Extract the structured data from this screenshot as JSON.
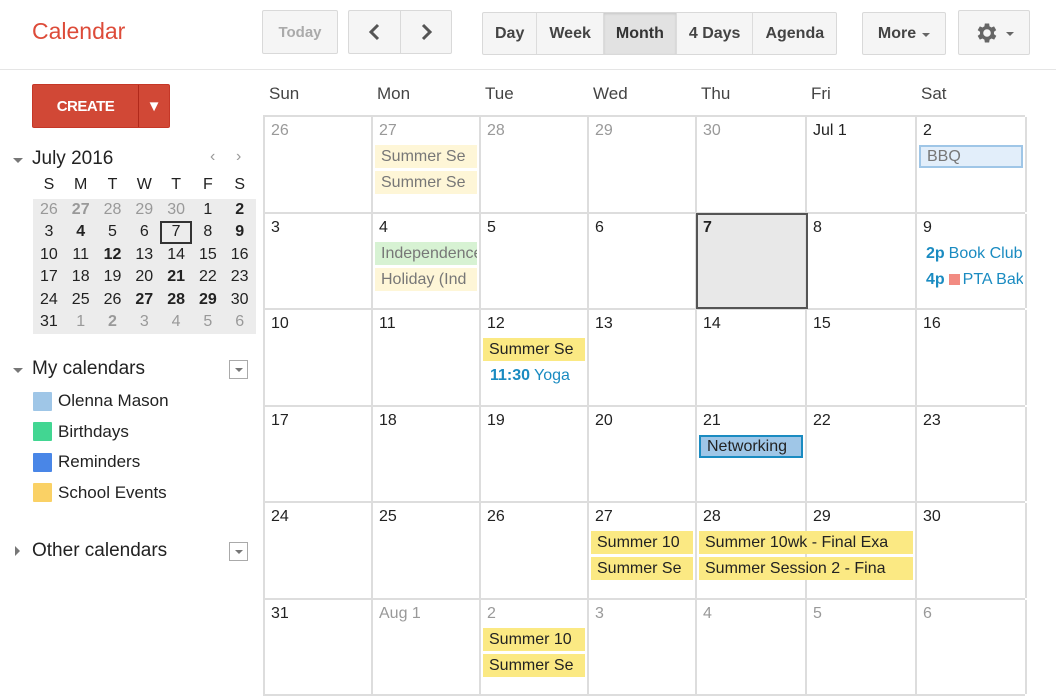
{
  "header": {
    "app_title": "Calendar",
    "today_label": "Today",
    "prev_label": "‹",
    "next_label": "›",
    "views": [
      {
        "label": "Day",
        "active": false
      },
      {
        "label": "Week",
        "active": false
      },
      {
        "label": "Month",
        "active": true
      },
      {
        "label": "4 Days",
        "active": false
      },
      {
        "label": "Agenda",
        "active": false
      }
    ],
    "more_label": "More",
    "settings_icon": "gear-icon"
  },
  "sidebar": {
    "create_label": "CREATE",
    "create_dropdown": "▼",
    "mini_calendar": {
      "title": "July 2016",
      "prev": "‹",
      "next": "›",
      "dow": [
        "S",
        "M",
        "T",
        "W",
        "T",
        "F",
        "S"
      ],
      "weeks": [
        [
          {
            "d": "26",
            "o": true
          },
          {
            "d": "27",
            "o": true,
            "b": true
          },
          {
            "d": "28",
            "o": true
          },
          {
            "d": "29",
            "o": true
          },
          {
            "d": "30",
            "o": true
          },
          {
            "d": "1"
          },
          {
            "d": "2",
            "b": true
          }
        ],
        [
          {
            "d": "3"
          },
          {
            "d": "4",
            "b": true
          },
          {
            "d": "5"
          },
          {
            "d": "6"
          },
          {
            "d": "7",
            "t": true
          },
          {
            "d": "8"
          },
          {
            "d": "9",
            "b": true
          }
        ],
        [
          {
            "d": "10"
          },
          {
            "d": "11"
          },
          {
            "d": "12",
            "b": true
          },
          {
            "d": "13"
          },
          {
            "d": "14"
          },
          {
            "d": "15"
          },
          {
            "d": "16"
          }
        ],
        [
          {
            "d": "17"
          },
          {
            "d": "18"
          },
          {
            "d": "19"
          },
          {
            "d": "20"
          },
          {
            "d": "21",
            "b": true
          },
          {
            "d": "22"
          },
          {
            "d": "23"
          }
        ],
        [
          {
            "d": "24"
          },
          {
            "d": "25"
          },
          {
            "d": "26"
          },
          {
            "d": "27",
            "b": true
          },
          {
            "d": "28",
            "b": true
          },
          {
            "d": "29",
            "b": true
          },
          {
            "d": "30"
          }
        ],
        [
          {
            "d": "31"
          },
          {
            "d": "1",
            "o": true
          },
          {
            "d": "2",
            "o": true,
            "b": true
          },
          {
            "d": "3",
            "o": true
          },
          {
            "d": "4",
            "o": true
          },
          {
            "d": "5",
            "o": true
          },
          {
            "d": "6",
            "o": true
          }
        ]
      ]
    },
    "my_calendars": {
      "title": "My calendars",
      "items": [
        {
          "label": "Olenna Mason",
          "color": "#9fc6e7"
        },
        {
          "label": "Birthdays",
          "color": "#42d692"
        },
        {
          "label": "Reminders",
          "color": "#4986e7"
        },
        {
          "label": "School Events",
          "color": "#fad165"
        }
      ]
    },
    "other_calendars": {
      "title": "Other calendars"
    }
  },
  "month": {
    "dow": [
      "Sun",
      "Mon",
      "Tue",
      "Wed",
      "Thu",
      "Fri",
      "Sat"
    ],
    "weeks": [
      [
        "26",
        "27",
        "28",
        "29",
        "30",
        "Jul 1",
        "2"
      ],
      [
        "3",
        "4",
        "5",
        "6",
        "7",
        "8",
        "9"
      ],
      [
        "10",
        "11",
        "12",
        "13",
        "14",
        "15",
        "16"
      ],
      [
        "17",
        "18",
        "19",
        "20",
        "21",
        "22",
        "23"
      ],
      [
        "24",
        "25",
        "26",
        "27",
        "28",
        "29",
        "30"
      ],
      [
        "31",
        "Aug 1",
        "2",
        "3",
        "4",
        "5",
        "6"
      ]
    ],
    "other_month": [
      [
        true,
        true,
        true,
        true,
        true,
        false,
        false
      ],
      [
        false,
        false,
        false,
        false,
        false,
        false,
        false
      ],
      [
        false,
        false,
        false,
        false,
        false,
        false,
        false
      ],
      [
        false,
        false,
        false,
        false,
        false,
        false,
        false
      ],
      [
        false,
        false,
        false,
        false,
        false,
        false,
        false
      ],
      [
        false,
        true,
        true,
        true,
        true,
        true,
        true
      ]
    ],
    "today": {
      "week": 1,
      "day": 4
    },
    "events": [
      {
        "week": 0,
        "day": 1,
        "span": 1,
        "slot": 0,
        "style": "school-faint",
        "text": "Summer Se"
      },
      {
        "week": 0,
        "day": 1,
        "span": 1,
        "slot": 1,
        "style": "school-faint",
        "text": "Summer Se"
      },
      {
        "week": 0,
        "day": 6,
        "span": 1,
        "slot": 0,
        "style": "bbq",
        "text": "BBQ"
      },
      {
        "week": 1,
        "day": 1,
        "span": 1,
        "slot": 0,
        "style": "holiday",
        "text": "Independence"
      },
      {
        "week": 1,
        "day": 1,
        "span": 1,
        "slot": 1,
        "style": "school-faint",
        "text": "Holiday (Ind"
      },
      {
        "week": 1,
        "day": 6,
        "span": 1,
        "slot": 0,
        "style": "timed",
        "time": "2p",
        "text": "Book Club"
      },
      {
        "week": 1,
        "day": 6,
        "span": 1,
        "slot": 1,
        "style": "timed",
        "time": "4p",
        "dot": true,
        "text": "PTA Bake"
      },
      {
        "week": 2,
        "day": 2,
        "span": 1,
        "slot": 0,
        "style": "school",
        "text": "Summer Se"
      },
      {
        "week": 2,
        "day": 2,
        "span": 1,
        "slot": 1,
        "style": "timed",
        "time": "11:30",
        "text": "Yoga"
      },
      {
        "week": 3,
        "day": 4,
        "span": 1,
        "slot": 0,
        "style": "network",
        "text": "Networking"
      },
      {
        "week": 4,
        "day": 3,
        "span": 1,
        "slot": 0,
        "style": "school",
        "text": "Summer 10"
      },
      {
        "week": 4,
        "day": 3,
        "span": 1,
        "slot": 1,
        "style": "school",
        "text": "Summer Se"
      },
      {
        "week": 4,
        "day": 4,
        "span": 2,
        "slot": 0,
        "style": "school",
        "text": "Summer 10wk - Final Exa"
      },
      {
        "week": 4,
        "day": 4,
        "span": 2,
        "slot": 1,
        "style": "school",
        "text": "Summer Session 2 - Fina"
      },
      {
        "week": 5,
        "day": 2,
        "span": 1,
        "slot": 0,
        "style": "school",
        "text": "Summer 10"
      },
      {
        "week": 5,
        "day": 2,
        "span": 1,
        "slot": 1,
        "style": "school",
        "text": "Summer Se"
      }
    ]
  }
}
